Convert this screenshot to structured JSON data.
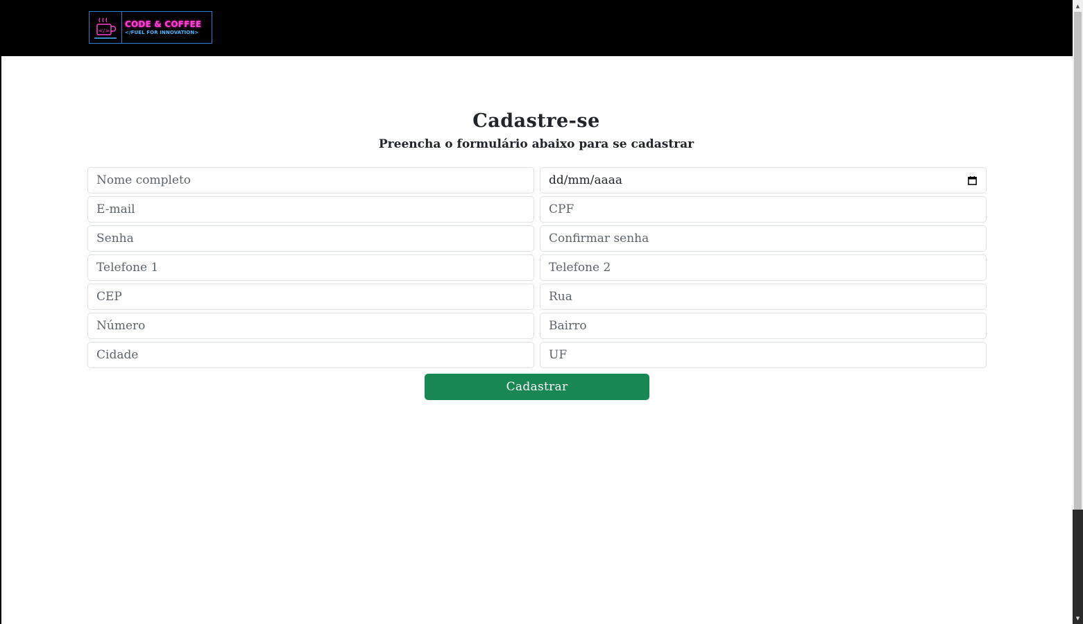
{
  "brand": {
    "title": "CODE & COFFEE",
    "tagline": "</FUEL FOR INNOVATION>",
    "icon": "coffee-cup-icon"
  },
  "form": {
    "heading": "Cadastre-se",
    "subheading": "Preencha o formulário abaixo para se cadastrar",
    "fields": {
      "nome": "Nome completo",
      "nascimento": "dd/mm/aaaa",
      "email": "E-mail",
      "cpf": "CPF",
      "senha": "Senha",
      "confirmar_senha": "Confirmar senha",
      "telefone1": "Telefone 1",
      "telefone2": "Telefone 2",
      "cep": "CEP",
      "rua": "Rua",
      "numero": "Número",
      "bairro": "Bairro",
      "cidade": "Cidade",
      "uf": "UF"
    },
    "submit_label": "Cadastrar"
  },
  "colors": {
    "navbar": "#000000",
    "logo_pink": "#ff3fd2",
    "logo_blue": "#4ab8ff",
    "button": "#198754"
  }
}
